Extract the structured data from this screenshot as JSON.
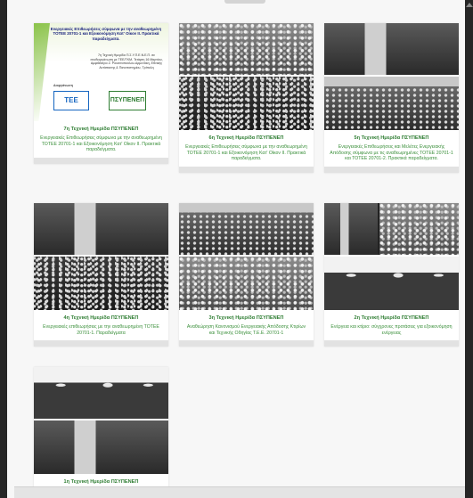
{
  "cards": [
    {
      "title": "7η Τεχνική Ημερίδα ΠΣΥΠΕΝΕΠ",
      "desc": "Ενεργειακές Επιθεωρήσεις σύμφωνα με την αναθεωρημένη ΤΟΤΕΕ 20701-1 και Εξοικονόμηση Κατ' Οίκον ΙΙ. Πρακτικά παραδείγματα.",
      "poster": {
        "title": "Ενεργειακές Επιθεωρήσεις σύμφωνα με την αναθεωρημένη ΤΟΤΕΕ 20701-1 και Εξοικονόμηση Κατ' Οίκον ΙΙ. Πρακτικά παραδείγματα.",
        "sub": "7η Τεχνική Ημερίδα Π.Σ.Υ.Π.Ε.Ν.Ε.Π. σε συνδιοργάνωση με ΤΕΕ/ΤΚΜ, Τετάρτη 16 Μαρτίου, Αμφιθέατρο Ζ. Ρουσσοπούλου-Αρμενάκη, Εθνικής Αντίστασης & Πανεπιστημίου, Τρίπολη",
        "org": "Διοργάνωση",
        "logo_left": "ΤΕΕ",
        "logo_right": "ΠΣΥΠΕΝΕΠ"
      }
    },
    {
      "title": "6η Τεχνική Ημερίδα ΠΣΥΠΕΝΕΠ",
      "desc": "Ενεργειακές Επιθεωρήσεις σύμφωνα με την αναθεωρημένη ΤΟΤΕΕ 20701-1 και Εξοικονόμηση Κατ' Οίκον ΙΙ. Πρακτικά παραδείγματα."
    },
    {
      "title": "5η Τεχνική Ημερίδα ΠΣΥΠΕΝΕΠ",
      "desc": "Ενεργειακές Επιθεωρήσεις και Μελέτες Ενεργειακής Απόδοσης σύμφωνα με τις αναθεωρημένες ΤΟΤΕΕ 20701-1 και ΤΟΤΕΕ 20701-2. Πρακτικά παραδείγματα."
    },
    {
      "title": "4η Τεχνική Ημερίδα ΠΣΥΠΕΝΕΠ",
      "desc": "Ενεργειακές επιθεωρήσεις με την αναθεωρημένη ΤΟΤΕΕ 20701-1. Παραδείγματα"
    },
    {
      "title": "3η Τεχνική Ημερίδα ΠΣΥΠΕΝΕΠ",
      "desc": "Αναθεώρηση Κανονισμού Ενεργειακής Απόδοσης Κτιρίων και Τεχνικής Οδηγίας Τ.Ε.Ε. 20701-1"
    },
    {
      "title": "2η Τεχνική Ημερίδα ΠΣΥΠΕΝΕΠ",
      "desc": "Ενέργεια και κτίριο: σύγχρονες προτάσεις για εξοικονόμηση ενέργειας"
    },
    {
      "title": "1η Τεχνική Ημερίδα ΠΣΥΠΕΝΕΠ",
      "desc": ""
    }
  ]
}
